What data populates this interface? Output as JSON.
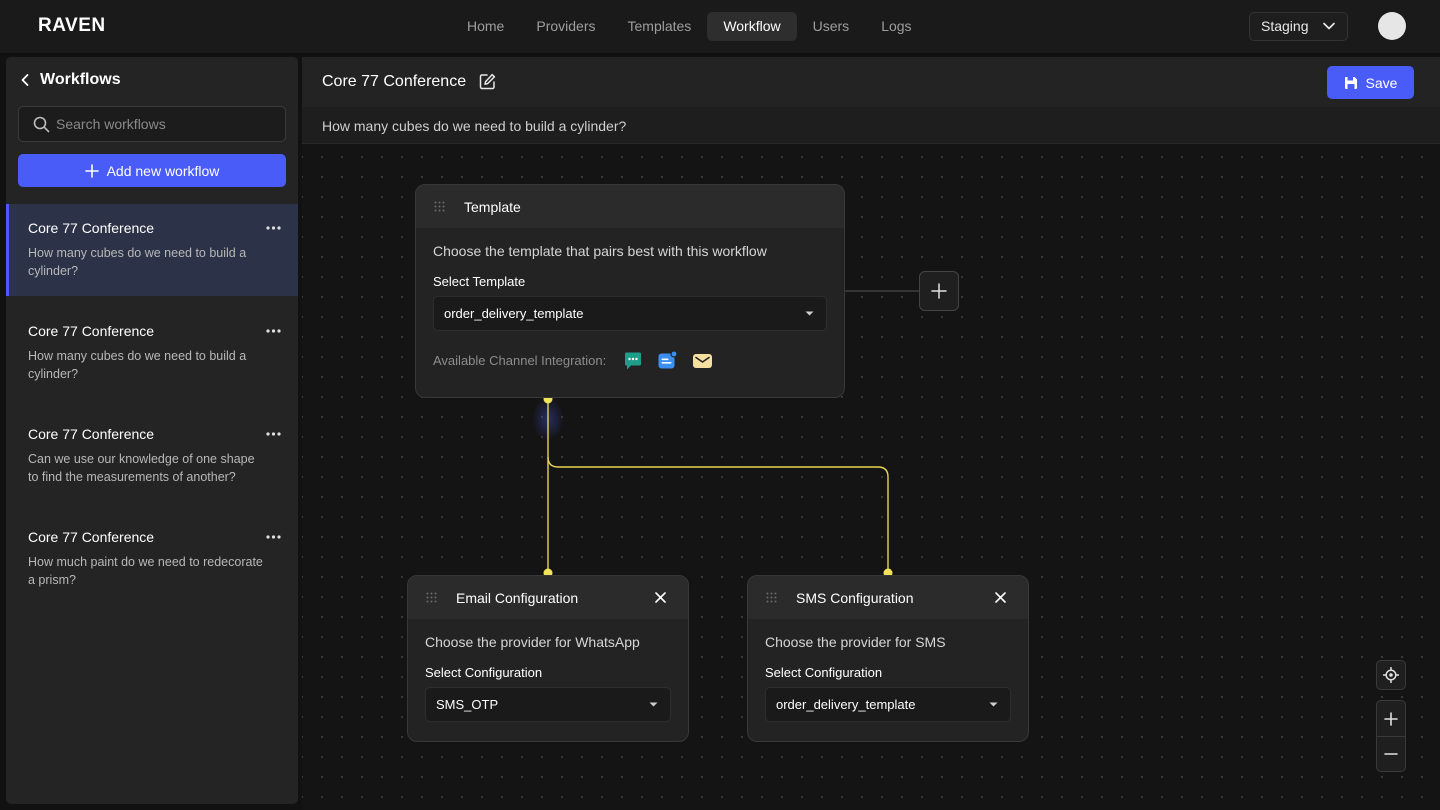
{
  "app": {
    "logo": "RAVEN"
  },
  "nav": {
    "items": [
      {
        "label": "Home"
      },
      {
        "label": "Providers"
      },
      {
        "label": "Templates"
      },
      {
        "label": "Workflow"
      },
      {
        "label": "Users"
      },
      {
        "label": "Logs"
      }
    ],
    "active": "Workflow"
  },
  "environment": {
    "selected": "Staging"
  },
  "sidebar": {
    "title": "Workflows",
    "search_placeholder": "Search workflows",
    "add_label": "Add new workflow",
    "items": [
      {
        "title": "Core 77 Conference",
        "desc": "How many cubes do we need to build a cylinder?"
      },
      {
        "title": "Core 77 Conference",
        "desc": "How many cubes do we need to build a cylinder?"
      },
      {
        "title": "Core 77 Conference",
        "desc": "Can we use our knowledge of one shape to find the measurements of another?"
      },
      {
        "title": "Core 77 Conference",
        "desc": "How much paint do we need to redecorate a prism?"
      }
    ]
  },
  "main": {
    "title": "Core 77 Conference",
    "subtitle": "How many cubes do we need to build a cylinder?",
    "save_label": "Save"
  },
  "nodes": {
    "template": {
      "title": "Template",
      "desc": "Choose the template that pairs best with this workflow",
      "label": "Select Template",
      "value": "order_delivery_template",
      "channels_label": "Available Channel Integration:",
      "channel_icons": [
        "chat-icon",
        "sms-icon",
        "mail-icon"
      ]
    },
    "email": {
      "title": "Email Configuration",
      "desc": "Choose the provider for WhatsApp",
      "label": "Select Configuration",
      "value": "SMS_OTP"
    },
    "sms": {
      "title": "SMS Configuration",
      "desc": "Choose the provider for SMS",
      "label": "Select Configuration",
      "value": "order_delivery_template"
    }
  },
  "colors": {
    "accent": "#4a5cf7",
    "connector": "#f3e35a",
    "chat_icon": "#1e9e8a",
    "sms_icon": "#3b8ff0",
    "mail_icon": "#f4dfa0"
  }
}
